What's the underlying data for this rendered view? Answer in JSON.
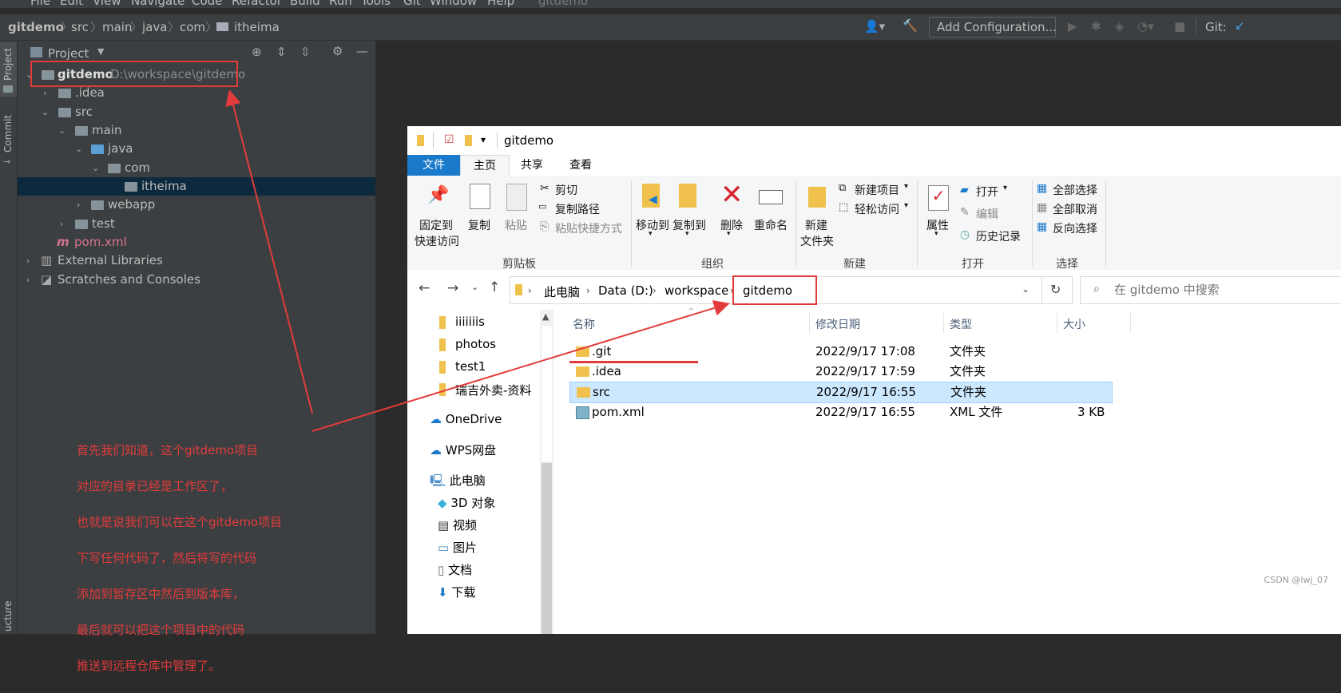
{
  "ide": {
    "menu": [
      "File",
      "Edit",
      "View",
      "Navigate",
      "Code",
      "Refactor",
      "Build",
      "Run",
      "Tools",
      "Git",
      "Window",
      "Help",
      "gitdemo"
    ],
    "breadcrumb": [
      "gitdemo",
      "src",
      "main",
      "java",
      "com",
      "itheima"
    ],
    "add_config_label": "Add Configuration...",
    "git_label": "Git:",
    "side_tabs": [
      "Project",
      "Commit",
      "ucture"
    ],
    "panel_title": "Project",
    "tree": [
      {
        "label": "gitdemo",
        "path": "D:\\workspace\\gitdemo"
      },
      {
        "label": ".idea"
      },
      {
        "label": "src"
      },
      {
        "label": "main"
      },
      {
        "label": "java"
      },
      {
        "label": "com"
      },
      {
        "label": "itheima"
      },
      {
        "label": "webapp"
      },
      {
        "label": "test"
      },
      {
        "label": "pom.xml"
      },
      {
        "label": "External Libraries"
      },
      {
        "label": "Scratches and Consoles"
      }
    ]
  },
  "explorer": {
    "title": "gitdemo",
    "tabs": [
      "文件",
      "主页",
      "共享",
      "查看"
    ],
    "ribbon": {
      "pin_label_1": "固定到",
      "pin_label_2": "快速访问",
      "copy_label": "复制",
      "paste_label": "粘贴",
      "cut_label": "剪切",
      "copy_path_label": "复制路径",
      "paste_shortcut_label": "粘贴快捷方式",
      "clipboard_group": "剪贴板",
      "move_to_label": "移动到",
      "copy_to_label": "复制到",
      "delete_label": "删除",
      "rename_label": "重命名",
      "organize_group": "组织",
      "new_folder_1": "新建",
      "new_folder_2": "文件夹",
      "new_item_label": "新建项目",
      "easy_access_label": "轻松访问",
      "new_group": "新建",
      "properties_label": "属性",
      "open_label": "打开",
      "edit_label": "编辑",
      "history_label": "历史记录",
      "open_group": "打开",
      "select_all_label": "全部选择",
      "select_none_label": "全部取消",
      "invert_label": "反向选择",
      "select_group": "选择"
    },
    "address": [
      "此电脑",
      "Data (D:)",
      "workspace",
      "gitdemo"
    ],
    "search_placeholder": "在 gitdemo 中搜索",
    "nav": [
      "iiiiiiis",
      "photos",
      "test1",
      "瑞吉外卖-资料",
      "OneDrive",
      "WPS网盘",
      "此电脑",
      "3D 对象",
      "视频",
      "图片",
      "文档",
      "下载"
    ],
    "columns": [
      "名称",
      "修改日期",
      "类型",
      "大小"
    ],
    "files": [
      {
        "name": ".git",
        "date": "2022/9/17 17:08",
        "type": "文件夹",
        "size": ""
      },
      {
        "name": ".idea",
        "date": "2022/9/17 17:59",
        "type": "文件夹",
        "size": ""
      },
      {
        "name": "src",
        "date": "2022/9/17 16:55",
        "type": "文件夹",
        "size": ""
      },
      {
        "name": "pom.xml",
        "date": "2022/9/17 16:55",
        "type": "XML 文件",
        "size": "3 KB"
      }
    ]
  },
  "annotation": {
    "lines": [
      "首先我们知道，这个gitdemo项目",
      "对应的目录已经是工作区了，",
      "也就是说我们可以在这个gitdemo项目",
      "下写任何代码了，然后将写的代码",
      "添加到暂存区中然后到版本库，",
      "最后就可以把这个项目中的代码",
      "推送到远程仓库中管理了。"
    ],
    "color": "#e33b3b"
  },
  "watermark": "CSDN @lwj_07"
}
